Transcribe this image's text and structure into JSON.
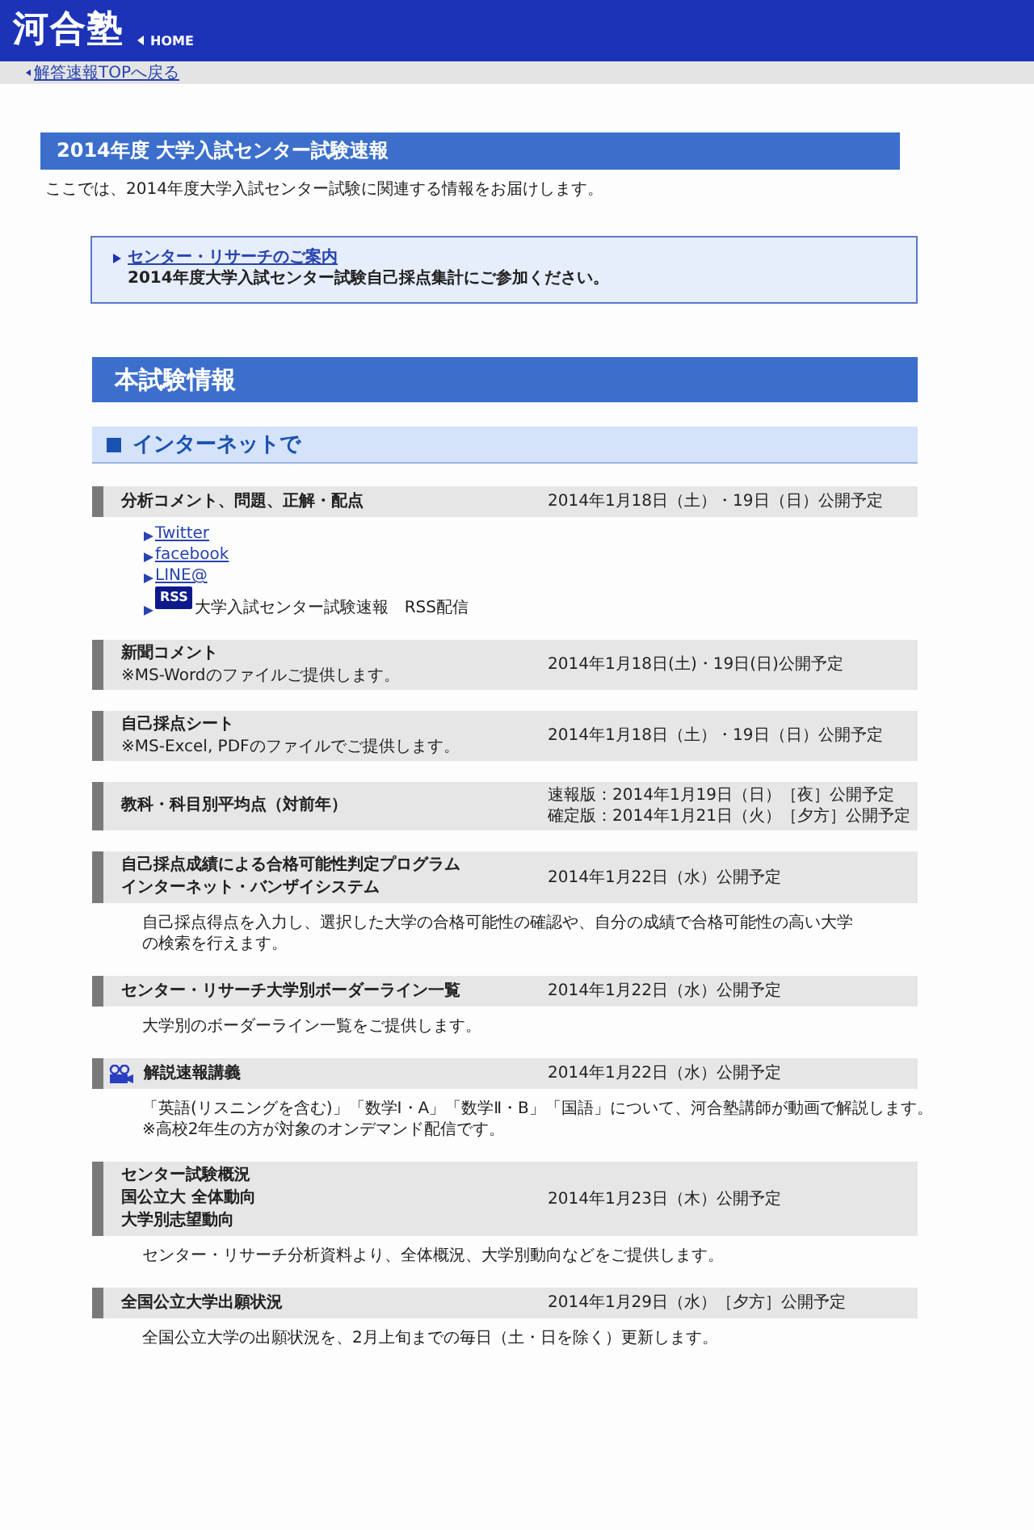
{
  "header": {
    "logo": "河合塾",
    "home_link": "HOME"
  },
  "back_link": "解答速報TOPへ戻る",
  "page_title": "2014年度 大学入試センター試験速報",
  "intro": "ここでは、2014年度大学入試センター試験に関連する情報をお届けします。",
  "notice": {
    "link": "センター・リサーチのご案内",
    "text": "2014年度大学入試センター試験自己採点集計にご参加ください。"
  },
  "section_title": "本試験情報",
  "subsection_title": "インターネットで",
  "items": [
    {
      "kind": "plain",
      "title_lines": [
        "分析コメント、問題、正解・配点"
      ],
      "dates": [
        "2014年1月18日（土）・19日（日）公開予定"
      ],
      "links": [
        {
          "kind": "link",
          "text": "Twitter"
        },
        {
          "kind": "link",
          "text": "facebook"
        },
        {
          "kind": "link",
          "text": "LINE@"
        },
        {
          "kind": "rss",
          "badge": "RSS",
          "text": "大学入試センター試験速報　RSS配信"
        }
      ]
    },
    {
      "kind": "plain",
      "title_lines": [
        "新聞コメント"
      ],
      "notes": [
        "※MS-Wordのファイルご提供します。"
      ],
      "dates": [
        "2014年1月18日(土)・19日(日)公開予定"
      ]
    },
    {
      "kind": "plain",
      "title_lines": [
        "自己採点シート"
      ],
      "notes": [
        "※MS-Excel, PDFのファイルでご提供します。"
      ],
      "dates": [
        "2014年1月18日（土）・19日（日）公開予定"
      ]
    },
    {
      "kind": "plain",
      "title_lines": [
        "教科・科目別平均点（対前年）"
      ],
      "dates": [
        "速報版：2014年1月19日（日）［夜］公開予定",
        "確定版：2014年1月21日（火）［夕方］公開予定"
      ]
    },
    {
      "kind": "plain",
      "title_lines": [
        "自己採点成績による合格可能性判定プログラム",
        "インターネット・バンザイシステム"
      ],
      "dates": [
        "2014年1月22日（水）公開予定"
      ],
      "description_lines": [
        "自己採点得点を入力し、選択した大学の合格可能性の確認や、自分の成績で合格可能性の高い大学",
        "の検索を行えます。"
      ]
    },
    {
      "kind": "plain",
      "title_lines": [
        "センター・リサーチ大学別ボーダーライン一覧"
      ],
      "dates": [
        "2014年1月22日（水）公開予定"
      ],
      "description_lines": [
        "大学別のボーダーライン一覧をご提供します。"
      ]
    },
    {
      "kind": "video",
      "title_lines": [
        "解説速報講義"
      ],
      "dates": [
        "2014年1月22日（水）公開予定"
      ],
      "description_lines": [
        "「英語(リスニングを含む)」「数学Ⅰ・A」「数学Ⅱ・B」「国語」について、河合塾講師が動画で解説します。",
        "※高校2年生の方が対象のオンデマンド配信です。"
      ]
    },
    {
      "kind": "plain",
      "title_lines": [
        "センター試験概況",
        "国公立大 全体動向",
        "大学別志望動向"
      ],
      "dates": [
        "2014年1月23日（木）公開予定"
      ],
      "description_lines": [
        "センター・リサーチ分析資料より、全体概況、大学別動向などをご提供します。"
      ]
    },
    {
      "kind": "plain",
      "title_lines": [
        "全国公立大学出願状況"
      ],
      "dates": [
        "2014年1月29日（水）［夕方］公開予定"
      ],
      "description_lines": [
        "全国公立大学の出願状況を、2月上旬までの毎日（土・日を除く）更新します。"
      ]
    }
  ]
}
